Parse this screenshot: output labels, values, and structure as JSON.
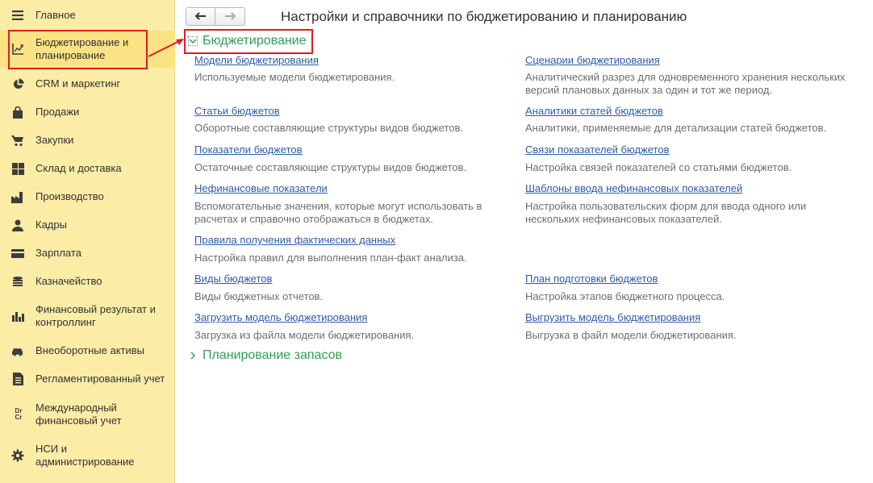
{
  "sidebar": {
    "items": [
      {
        "label": "Главное",
        "icon": "menu-icon"
      },
      {
        "label": "Бюджетирование и планирование",
        "label_line1": "Бюджетирование и",
        "label_line2": "планирование",
        "icon": "budget-chart-icon"
      },
      {
        "label": "CRM и маркетинг",
        "icon": "pie-chart-icon"
      },
      {
        "label": "Продажи",
        "icon": "shopping-bag-icon"
      },
      {
        "label": "Закупки",
        "icon": "cart-icon"
      },
      {
        "label": "Склад и доставка",
        "icon": "warehouse-grid-icon"
      },
      {
        "label": "Производство",
        "icon": "factory-icon"
      },
      {
        "label": "Кадры",
        "icon": "person-icon"
      },
      {
        "label": "Зарплата",
        "icon": "wallet-icon"
      },
      {
        "label": "Казначейство",
        "icon": "coins-icon"
      },
      {
        "label_line1": "Финансовый результат и",
        "label_line2": "контроллинг",
        "icon": "bar-chart-icon"
      },
      {
        "label": "Внеоборотные активы",
        "icon": "car-icon"
      },
      {
        "label": "Регламентированный учет",
        "icon": "document-icon"
      },
      {
        "label_line1": "Международный",
        "label_line2": "финансовый учет",
        "icon": "dr-cr-icon",
        "icon_text_top": "Dr",
        "icon_text_bottom": "Cr"
      },
      {
        "label_line1": "НСИ и",
        "label_line2": "администрирование",
        "icon": "gear-icon"
      }
    ]
  },
  "toolbar": {
    "back_icon": "arrow-left-icon",
    "forward_icon": "arrow-right-icon"
  },
  "page": {
    "title": "Настройки и справочники по бюджетированию и планированию"
  },
  "groups": {
    "budgeting": {
      "title": "Бюджетирование",
      "left": [
        {
          "link": "Модели бюджетирования",
          "desc": "Используемые модели бюджетирования."
        },
        {
          "link": "Статьи бюджетов",
          "desc": "Оборотные составляющие структуры видов бюджетов."
        },
        {
          "link": "Показатели бюджетов",
          "desc": "Остаточные составляющие структуры видов бюджетов."
        },
        {
          "link": "Нефинансовые показатели",
          "desc_line1": "Вспомогательные значения, которые могут использовать в",
          "desc_line2": "расчетах и справочно отображаться в бюджетах."
        },
        {
          "link": "Правила получения фактических данных",
          "desc": "Настройка правил для выполнения план-факт анализа."
        },
        {
          "link": "Виды бюджетов",
          "desc": "Виды бюджетных отчетов."
        },
        {
          "link": "Загрузить модель бюджетирования",
          "desc": "Загрузка из файла модели бюджетирования."
        }
      ],
      "right": [
        {
          "link": "Сценарии бюджетирования",
          "desc_line1": "Аналитический разрез для одновременного хранения нескольких",
          "desc_line2": "версий плановых данных за один и тот же период."
        },
        {
          "link": "Аналитики статей бюджетов",
          "desc": "Аналитики, применяемые для детализации статей бюджетов."
        },
        {
          "link": "Связи показателей бюджетов",
          "desc": "Настройка связей показателей со статьями бюджетов."
        },
        {
          "link": "Шаблоны ввода нефинансовых показателей",
          "desc_line1": "Настройка пользовательских форм для ввода одного или",
          "desc_line2": "нескольких нефинансовых показателей."
        },
        {
          "link": "План подготовки бюджетов",
          "desc": "Настройка этапов бюджетного процесса."
        },
        {
          "link": "Выгрузить модель бюджетирования",
          "desc": "Выгрузка в файл модели бюджетирования."
        }
      ]
    },
    "inventory": {
      "title": "Планирование запасов"
    }
  },
  "colors": {
    "sidebar_bg": "#fbeca6",
    "link": "#2d5caa",
    "group_title": "#2f9e57",
    "highlight": "#e11b22"
  }
}
